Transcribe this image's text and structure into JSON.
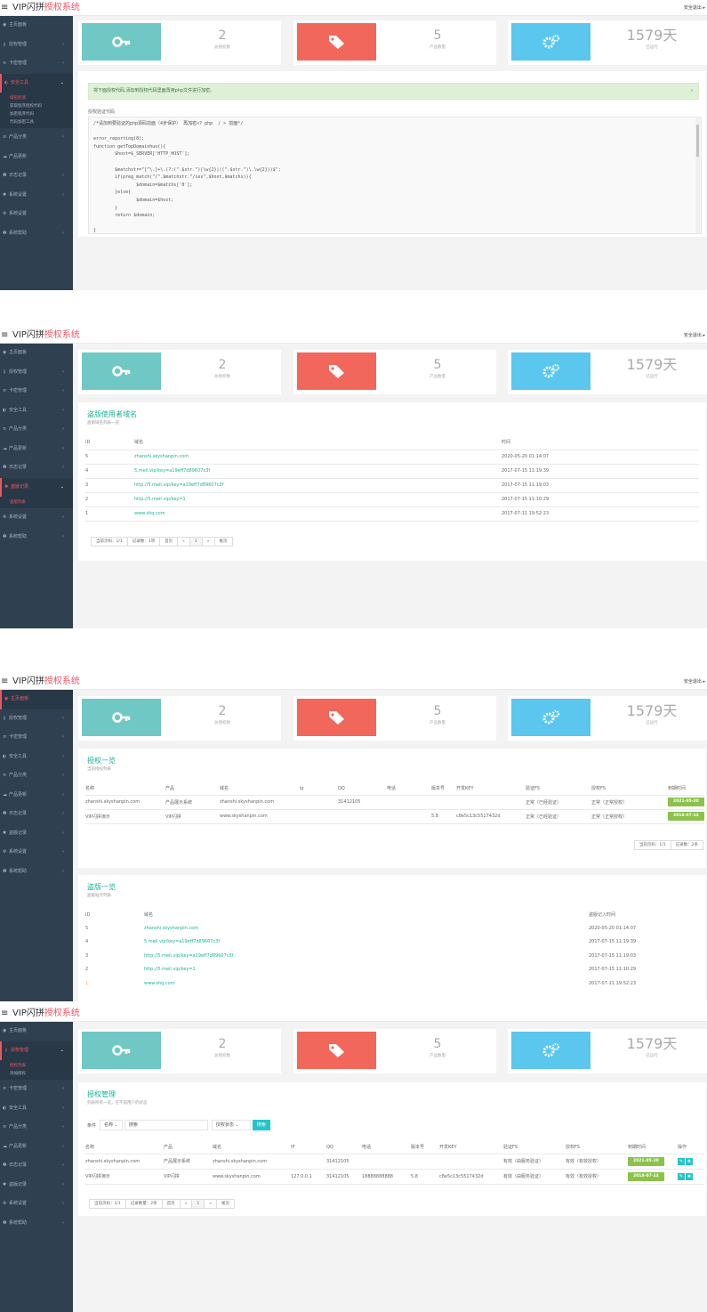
{
  "app": {
    "title_a": "VIP闪拼",
    "title_b": "授权系统",
    "menu_icon": "hamburger-icon",
    "user": "安全退出 ▸",
    "brand_red": "#ed5565",
    "sidebar_bg": "#2f4050"
  },
  "sidebar1": [
    {
      "icon": "dashboard-icon",
      "label": "主页面板",
      "arrow": ""
    },
    {
      "icon": "key-icon",
      "label": "授权管理",
      "arrow": "‹"
    },
    {
      "icon": "list-icon",
      "label": "卡密管理",
      "arrow": "‹"
    },
    {
      "icon": "shield-icon",
      "label": "安全工具",
      "arrow": "⌄",
      "active": true
    },
    {
      "icon": "list-icon",
      "label": "产品分类",
      "arrow": "‹"
    },
    {
      "icon": "cloud-icon",
      "label": "产品更新",
      "arrow": ""
    },
    {
      "icon": "info-icon",
      "label": "日志记录",
      "arrow": "‹"
    },
    {
      "icon": "gear-icon",
      "label": "系统设置",
      "arrow": "‹"
    },
    {
      "icon": "gears-icon",
      "label": "系统设置",
      "arrow": ""
    },
    {
      "icon": "question-icon",
      "label": "系统帮助",
      "arrow": "‹"
    }
  ],
  "sidebar1_sub": [
    "域名检测",
    "获取程序授权代码",
    "加密程序代码",
    "代码加密工具"
  ],
  "sidebar2": [
    {
      "icon": "dashboard-icon",
      "label": "主页面板",
      "arrow": ""
    },
    {
      "icon": "key-icon",
      "label": "授权管理",
      "arrow": "‹"
    },
    {
      "icon": "list-icon",
      "label": "卡密管理",
      "arrow": "‹"
    },
    {
      "icon": "shield-icon",
      "label": "安全工具",
      "arrow": "‹"
    },
    {
      "icon": "list-icon",
      "label": "产品分类",
      "arrow": "‹"
    },
    {
      "icon": "cloud-icon",
      "label": "产品更新",
      "arrow": "‹"
    },
    {
      "icon": "info-icon",
      "label": "日志记录",
      "arrow": "‹"
    },
    {
      "icon": "gear-icon",
      "label": "盗版记录",
      "arrow": "⌄",
      "active": true
    },
    {
      "icon": "gears-icon",
      "label": "系统设置",
      "arrow": "‹"
    },
    {
      "icon": "question-icon",
      "label": "系统帮助",
      "arrow": "‹"
    }
  ],
  "sidebar2_sub": [
    "盗版列表"
  ],
  "sidebar3": [
    {
      "icon": "dashboard-icon",
      "label": "主页面板",
      "arrow": "",
      "active": true
    },
    {
      "icon": "key-icon",
      "label": "授权管理",
      "arrow": "‹"
    },
    {
      "icon": "list-icon",
      "label": "卡密管理",
      "arrow": "‹"
    },
    {
      "icon": "shield-icon",
      "label": "安全工具",
      "arrow": "‹"
    },
    {
      "icon": "list-icon",
      "label": "产品分类",
      "arrow": "‹"
    },
    {
      "icon": "cloud-icon",
      "label": "产品更新",
      "arrow": "‹"
    },
    {
      "icon": "info-icon",
      "label": "日志记录",
      "arrow": "‹"
    },
    {
      "icon": "gear-icon",
      "label": "盗版记录",
      "arrow": "‹"
    },
    {
      "icon": "gears-icon",
      "label": "系统设置",
      "arrow": "‹"
    },
    {
      "icon": "question-icon",
      "label": "系统帮助",
      "arrow": "‹"
    }
  ],
  "sidebar4": [
    {
      "icon": "dashboard-icon",
      "label": "主页面板",
      "arrow": ""
    },
    {
      "icon": "key-icon",
      "label": "授权管理",
      "arrow": "⌄",
      "active": true
    },
    {
      "icon": "list-icon",
      "label": "卡密管理",
      "arrow": "‹"
    },
    {
      "icon": "shield-icon",
      "label": "安全工具",
      "arrow": "‹"
    },
    {
      "icon": "list-icon",
      "label": "产品分类",
      "arrow": "‹"
    },
    {
      "icon": "cloud-icon",
      "label": "产品更新",
      "arrow": "‹"
    },
    {
      "icon": "info-icon",
      "label": "日志记录",
      "arrow": "‹"
    },
    {
      "icon": "gear-icon",
      "label": "盗版记录",
      "arrow": "‹"
    },
    {
      "icon": "gears-icon",
      "label": "系统设置",
      "arrow": "‹"
    },
    {
      "icon": "question-icon",
      "label": "系统帮助",
      "arrow": "‹"
    }
  ],
  "sidebar4_sub": [
    "授权列表",
    "添加授权"
  ],
  "stats": {
    "auth_count": "2",
    "auth_label": "总授权数",
    "product_count": "5",
    "product_label": "产品数量",
    "days": "1579天",
    "days_label": "已运行",
    "colors": [
      "#70c8c4",
      "#f2675b",
      "#5bc6ee"
    ],
    "icons": [
      "key-icon",
      "tag-icon",
      "gears-icon"
    ]
  },
  "security": {
    "alert": "将下面授权代码,添加到授权代码里面再用php文件进行加密。",
    "label": "授权验证代码",
    "code": [
      "/*请加到要验证的php源码前面（4步保护） 再加密<? php  / > 前面*/",
      "",
      "error_reporting(0);",
      "function getTopDomainhuo(){",
      "        $host=$_SERVER['HTTP_HOST'];",
      "",
      "        $matchstr=\"[^\\.]+\\.(?:(\".$str.\")|\\w{2}|((\".$str.\")\\.\\w{2}))$\";",
      "        if(preg_match(\"/\".$matchstr.\"/ies\",$host,$matchs)){",
      "                $domain=$matchs['0'];",
      "        }else{",
      "                $domain=$host;",
      "        }",
      "        return $domain;",
      "",
      "}"
    ]
  },
  "piracy": {
    "title": "盗版使用者域名",
    "subtitle": "盗版域名列表一览",
    "headers": [
      "ID",
      "域名",
      "时间"
    ],
    "rows": [
      [
        "5",
        "zhanshi.skyshanpin.com",
        "2020-05-20 01:14:07"
      ],
      [
        "4",
        "5.meil.vip/key=a19eff7d89607c3f",
        "2017-07-15 11:19:39"
      ],
      [
        "3",
        "http://5.meil.vip/key=a19eff7d89607c3f",
        "2017-07-15 11:19:03"
      ],
      [
        "2",
        "http://5.meil.vip/key=1",
        "2017-07-15 11:10:29"
      ],
      [
        "1",
        "www.shq.com",
        "2017-07-11 19:52:23"
      ]
    ],
    "pager": [
      "当前页码：1/1",
      "记录数：1项",
      "首页",
      "«",
      "1",
      "»",
      "尾页"
    ]
  },
  "dashboard": {
    "auth_title": "授权一览",
    "auth_sub": "当前授权列表",
    "auth_headers": [
      "名称",
      "产品",
      "域名",
      "ip",
      "QQ",
      "电话",
      "版本号",
      "开发KEY",
      "验证FS",
      "授权FS",
      "到期时间"
    ],
    "auth_rows": [
      [
        "zhanshi.skyshanpin.com",
        "产品展示系统",
        "zhanshi.skyshanpin.com",
        "",
        "31412105",
        "",
        "",
        "",
        "正常（已经验证）",
        "正常（正常授权）",
        "2021-05-20"
      ],
      [
        "VIP闪拼演示",
        "VIP闪拼",
        "www.skyshanpin.com",
        "",
        "",
        "",
        "5.8",
        "c8e5c13c5517432d",
        "正常（已经验证）",
        "正常（正常授权）",
        "2018-07-14"
      ]
    ],
    "auth_pager": [
      "当前页码：1/1",
      "记录数：2条"
    ],
    "piracy_title": "盗版一览",
    "piracy_sub": "盗版站点列表",
    "piracy_headers": [
      "ID",
      "域名",
      "盗版记入时间"
    ],
    "piracy_rows": [
      [
        "5",
        "zhanshi.skyshanpin.com",
        "2020-05-20 01:14:07"
      ],
      [
        "4",
        "5.meil.vip/key=a19eff7d89607c3f",
        "2017-07-15 11:19:39"
      ],
      [
        "3",
        "http://5.meil.vip/key=a19eff7d89607c3f",
        "2017-07-15 11:19:03"
      ],
      [
        "2",
        "http://5.meil.vip/key=1",
        "2017-07-15 11:10:29"
      ],
      [
        "1",
        "www.shq.com",
        "2017-07-11 19:52:23"
      ]
    ]
  },
  "authlist": {
    "title": "授权管理",
    "subtitle": "列表所有一览，在不前用户的状态",
    "search_label": "条件",
    "search_field": "名称",
    "search_value": "搜索",
    "select": "授权状态",
    "search_btn": "搜索",
    "headers": [
      "名称",
      "产品",
      "域名",
      "IP",
      "QQ",
      "电话",
      "版本号",
      "开发KEY",
      "验证FS",
      "授权FS",
      "到期时间",
      "操作"
    ],
    "rows": [
      [
        "zhanshi.skyshanpin.com",
        "产品展示系统",
        "zhanshi.skyshanpin.com",
        "",
        "31412105",
        "",
        "",
        "",
        "有效（由服务验证）",
        "有效（有效授权）",
        "2021-05-20"
      ],
      [
        "VIP闪拼演示",
        "VIP闪拼",
        "www.skyshanpin.com",
        "127.0.0.1",
        "31412105",
        "18888888888",
        "5.8",
        "c8e5c13c5517432d",
        "有效（由服务验证）",
        "有效（有效授权）",
        "2018-07-14"
      ]
    ],
    "edit_icon": "edit-icon",
    "delete_icon": "delete-icon",
    "pager": [
      "当前页码：1/1",
      "记录数量：2条",
      "首页",
      "«",
      "1",
      "»",
      "尾页"
    ]
  }
}
